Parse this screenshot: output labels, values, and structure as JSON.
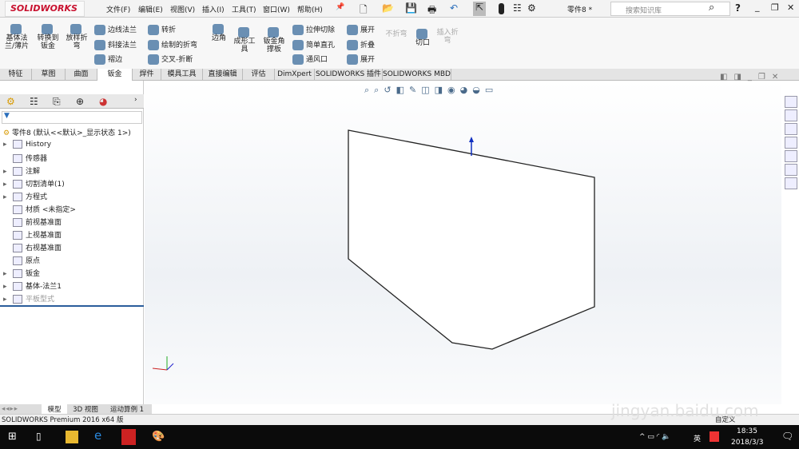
{
  "app": {
    "logo": "SOLIDWORKS",
    "doc_title": "零件8 *",
    "search_placeholder": "搜索知识库"
  },
  "menu": [
    "文件(F)",
    "编辑(E)",
    "视图(V)",
    "插入(I)",
    "工具(T)",
    "窗口(W)",
    "帮助(H)"
  ],
  "ribbon": {
    "big": [
      "基体法兰/薄片",
      "转换到钣金",
      "放样折弯",
      "边角",
      "成形工具",
      "钣金角撑板",
      "不折弯",
      "切口",
      "插入折弯"
    ],
    "small": [
      "边线法兰",
      "斜接法兰",
      "褶边",
      "转折",
      "绘制的折弯",
      "交叉-折断",
      "拉伸切除",
      "简单直孔",
      "通风口",
      "展开",
      "折叠",
      "展开"
    ]
  },
  "tabs": [
    "特征",
    "草图",
    "曲面",
    "钣金",
    "焊件",
    "模具工具",
    "直接编辑",
    "评估",
    "DimXpert",
    "SOLIDWORKS 插件",
    "SOLIDWORKS MBD"
  ],
  "active_tab": "钣金",
  "tree": {
    "root": "零件8  (默认<<默认>_显示状态 1>)",
    "items": [
      {
        "label": "History",
        "arrow": true
      },
      {
        "label": "传感器",
        "arrow": false
      },
      {
        "label": "注解",
        "arrow": true
      },
      {
        "label": "切割清单(1)",
        "arrow": true
      },
      {
        "label": "方程式",
        "arrow": true
      },
      {
        "label": "材质 <未指定>",
        "arrow": false
      },
      {
        "label": "前视基准面",
        "arrow": false
      },
      {
        "label": "上视基准面",
        "arrow": false
      },
      {
        "label": "右视基准面",
        "arrow": false
      },
      {
        "label": "原点",
        "arrow": false
      },
      {
        "label": "钣金",
        "arrow": true
      },
      {
        "label": "基体-法兰1",
        "arrow": true
      },
      {
        "label": "平板型式",
        "arrow": true
      }
    ]
  },
  "bottom_tabs": [
    "模型",
    "3D 视图",
    "运动算例 1"
  ],
  "status": {
    "text": "SOLIDWORKS Premium 2016 x64 版",
    "right": "自定义"
  },
  "taskbar": {
    "time": "18:35",
    "date": "2018/3/3",
    "ime": "英"
  },
  "watermark": "jingyan.baidu.com"
}
